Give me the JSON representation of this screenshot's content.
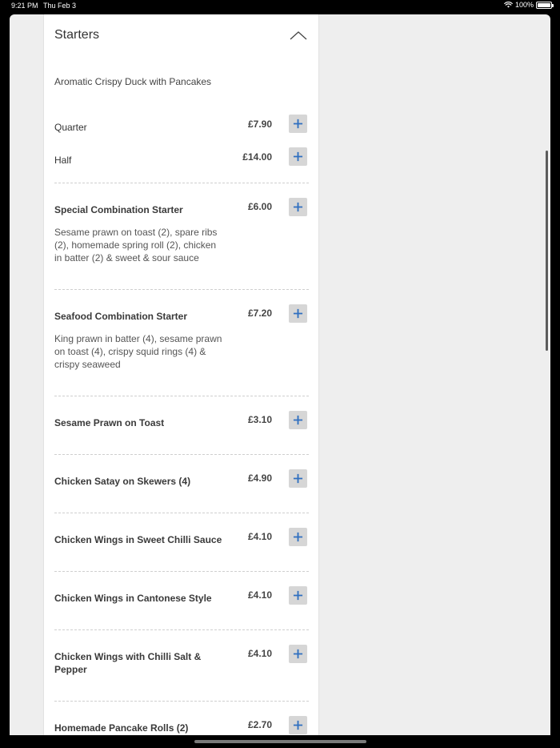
{
  "status_bar": {
    "time": "9:21 PM",
    "date": "Thu Feb 3",
    "battery": "100%",
    "icons": [
      "wifi-icon",
      "battery-icon"
    ]
  },
  "menu": {
    "section_title": "Starters",
    "collapse_icon": "chevron-up-icon",
    "add_icon": "plus-icon",
    "accent_color": "#2f6fc0",
    "group": {
      "title": "Aromatic Crispy Duck with Pancakes",
      "options": [
        {
          "name": "Quarter",
          "price": "£7.90"
        },
        {
          "name": "Half",
          "price": "£14.00"
        }
      ]
    },
    "items": [
      {
        "name": "Special Combination Starter",
        "price": "£6.00",
        "description": "Sesame prawn on toast (2), spare ribs (2), homemade spring roll (2), chicken in batter (2) & sweet & sour sauce"
      },
      {
        "name": "Seafood Combination Starter",
        "price": "£7.20",
        "description": "King prawn in batter (4), sesame prawn on toast (4), crispy squid rings (4) & crispy seaweed"
      },
      {
        "name": "Sesame Prawn on Toast",
        "price": "£3.10"
      },
      {
        "name": "Chicken Satay on Skewers (4)",
        "price": "£4.90"
      },
      {
        "name": "Chicken Wings in Sweet Chilli Sauce",
        "price": "£4.10"
      },
      {
        "name": "Chicken Wings in Cantonese Style",
        "price": "£4.10"
      },
      {
        "name": "Chicken Wings with Chilli Salt & Pepper",
        "price": "£4.10"
      },
      {
        "name": "Homemade Pancake Rolls (2)",
        "price": "£2.70"
      }
    ]
  }
}
